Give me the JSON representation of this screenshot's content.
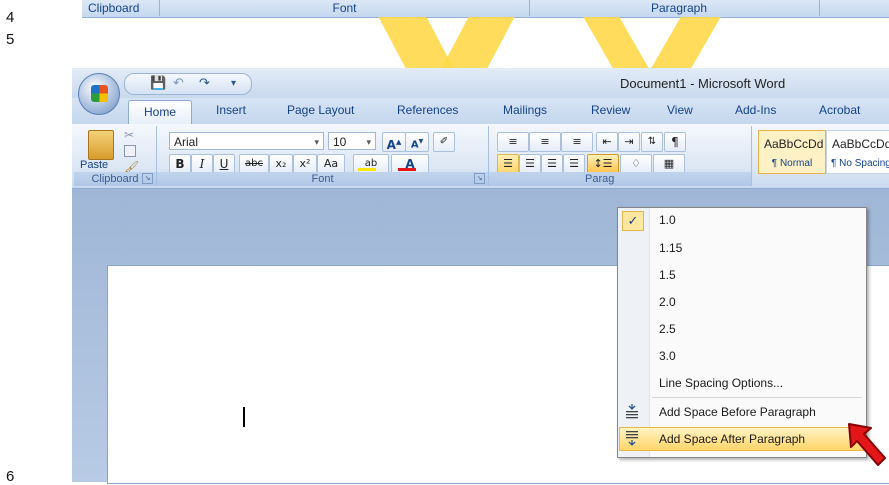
{
  "line_numbers": [
    "4",
    "5",
    "6"
  ],
  "top_strip": {
    "groups": [
      "Clipboard",
      "Font",
      "Paragraph"
    ]
  },
  "window": {
    "title": "Document1 - Microsoft Word",
    "tabs": [
      "Home",
      "Insert",
      "Page Layout",
      "References",
      "Mailings",
      "Review",
      "View",
      "Add-Ins",
      "Acrobat"
    ],
    "active_tab": "Home"
  },
  "ribbon": {
    "clipboard": {
      "paste_label": "Paste",
      "group_label": "Clipboard"
    },
    "font": {
      "font_name": "Arial",
      "font_size": "10",
      "group_label": "Font",
      "bold": "B",
      "italic": "I",
      "underline": "U",
      "strike": "abc",
      "subscript": "x₂",
      "superscript": "x²",
      "change_case": "Aa",
      "grow": "A",
      "shrink": "A"
    },
    "paragraph": {
      "group_label": "Parag"
    },
    "styles": [
      {
        "preview": "AaBbCcDd",
        "name": "¶ Normal"
      },
      {
        "preview": "AaBbCcDd",
        "name": "¶ No Spacing"
      }
    ]
  },
  "menu": {
    "items": [
      "1.0",
      "1.15",
      "1.5",
      "2.0",
      "2.5",
      "3.0",
      "Line Spacing Options...",
      "Add Space Before Paragraph",
      "Add Space After Paragraph"
    ],
    "checked": "1.0",
    "highlighted": "Add Space After Paragraph"
  },
  "colors": {
    "highlight": "#ffd56a",
    "watermark": "#ffd84a",
    "arrow": "#e3161a",
    "font_color_bar": "#e3161a",
    "highlight_color_bar": "#ffe800"
  }
}
